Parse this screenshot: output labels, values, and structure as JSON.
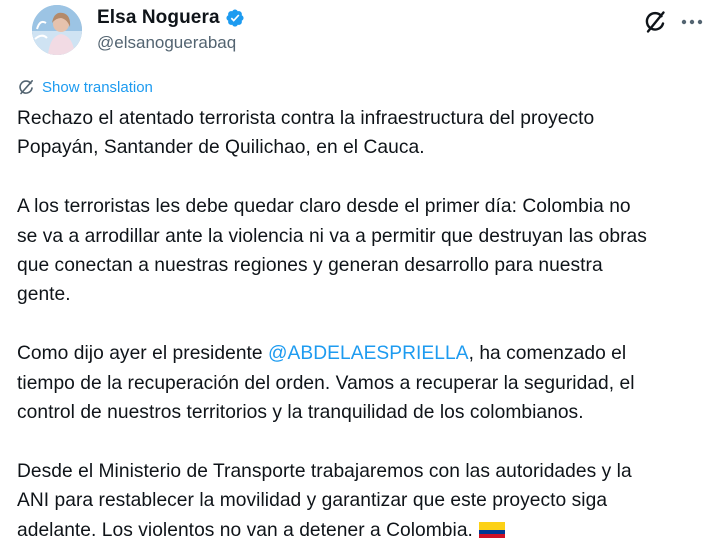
{
  "author": {
    "display_name": "Elsa Noguera",
    "handle": "@elsanoguerabaq",
    "avatar_icon": "profile-photo",
    "verified_icon": "verified-badge-icon",
    "verified_color": "#1d9bf0"
  },
  "actions": {
    "grok_icon": "grok-icon",
    "more_icon": "more-options-icon"
  },
  "translation": {
    "label": "Show translation",
    "icon": "globe-icon"
  },
  "tweet": {
    "paragraphs": [
      {
        "lines": [
          "Rechazo el atentado terrorista contra la infraestructura del proyecto",
          "Popayán, Santander de Quilichao, en el Cauca."
        ]
      },
      {
        "lines": [
          "A los terroristas les debe quedar claro desde el primer día: Colombia no",
          "se va a arrodillar ante la violencia ni va a permitir que destruyan las obras",
          "que conectan a nuestras regiones y generan desarrollo para nuestra",
          "gente."
        ]
      },
      {
        "line1_before": "Como dijo ayer el presidente ",
        "mention": "@ABDELAESPRIELLA",
        "line1_after": ", ha comenzado el",
        "lines": [
          "tiempo de la recuperación del orden. Vamos a recuperar la seguridad, el",
          "control de nuestros territorios y la tranquilidad de los colombianos."
        ]
      },
      {
        "lines": [
          "Desde el Ministerio de Transporte trabajaremos con las autoridades y la",
          "ANI para restablecer la movilidad y garantizar que este proyecto siga",
          "adelante. Los violentos no van a detener a Colombia."
        ],
        "emoji": "colombia-flag-icon"
      }
    ]
  },
  "colors": {
    "text": "#0f1419",
    "secondary": "#536471",
    "accent": "#1d9bf0"
  }
}
